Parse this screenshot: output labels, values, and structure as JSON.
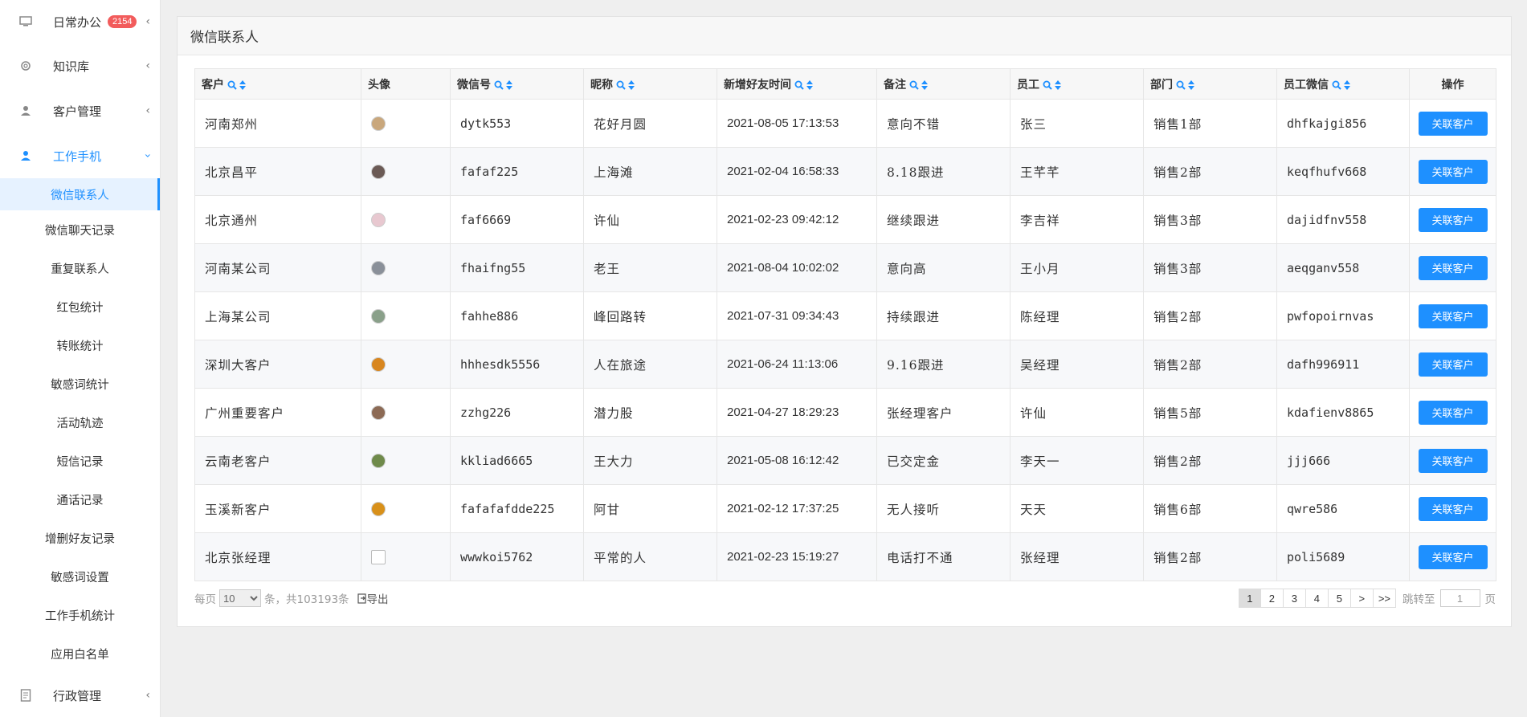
{
  "sidebar": {
    "top_items": [
      {
        "label": "日常办公",
        "icon": "monitor-icon",
        "badge": "2154"
      },
      {
        "label": "知识库",
        "icon": "gear-icon"
      },
      {
        "label": "客户管理",
        "icon": "user-icon"
      },
      {
        "label": "工作手机",
        "icon": "user-icon"
      }
    ],
    "sub_items": [
      "微信联系人",
      "微信聊天记录",
      "重复联系人",
      "红包统计",
      "转账统计",
      "敏感词统计",
      "活动轨迹",
      "短信记录",
      "通话记录",
      "增删好友记录",
      "敏感词设置",
      "工作手机统计",
      "应用白名单"
    ],
    "bottom_item": {
      "label": "行政管理",
      "icon": "document-icon"
    }
  },
  "panel": {
    "title": "微信联系人"
  },
  "table": {
    "headers": [
      "客户",
      "头像",
      "微信号",
      "昵称",
      "新增好友时间",
      "备注",
      "员工",
      "部门",
      "员工微信",
      "操作"
    ],
    "action_label": "关联客户",
    "rows": [
      {
        "customer": "河南郑州",
        "avatar_color": "#c9a77c",
        "wechat": "dytk553",
        "nickname": "花好月圆",
        "time": "2021-08-05 17:13:53",
        "remark": "意向不错",
        "staff": "张三",
        "dept": "销售1部",
        "staff_wechat": "dhfkajgi856"
      },
      {
        "customer": "北京昌平",
        "avatar_color": "#6b5a55",
        "wechat": "fafaf225",
        "nickname": "上海滩",
        "time": "2021-02-04 16:58:33",
        "remark": "8.18跟进",
        "staff": "王芊芊",
        "dept": "销售2部",
        "staff_wechat": "keqfhufv668"
      },
      {
        "customer": "北京通州",
        "avatar_color": "#e8c8d0",
        "wechat": "faf6669",
        "nickname": "许仙",
        "time": "2021-02-23 09:42:12",
        "remark": "继续跟进",
        "staff": "李吉祥",
        "dept": "销售3部",
        "staff_wechat": "dajidfnv558"
      },
      {
        "customer": "河南某公司",
        "avatar_color": "#8a9099",
        "wechat": "fhaifng55",
        "nickname": "老王",
        "time": "2021-08-04 10:02:02",
        "remark": "意向高",
        "staff": "王小月",
        "dept": "销售3部",
        "staff_wechat": "aeqganv558"
      },
      {
        "customer": "上海某公司",
        "avatar_color": "#8aa08a",
        "wechat": "fahhe886",
        "nickname": "峰回路转",
        "time": "2021-07-31 09:34:43",
        "remark": "持续跟进",
        "staff": "陈经理",
        "dept": "销售2部",
        "staff_wechat": "pwfopoirnvas"
      },
      {
        "customer": "深圳大客户",
        "avatar_color": "#d8861f",
        "wechat": "hhhesdk5556",
        "nickname": "人在旅途",
        "time": "2021-06-24 11:13:06",
        "remark": "9.16跟进",
        "staff": "吴经理",
        "dept": "销售2部",
        "staff_wechat": "dafh996911"
      },
      {
        "customer": "广州重要客户",
        "avatar_color": "#8c6a55",
        "wechat": "zzhg226",
        "nickname": "潜力股",
        "time": "2021-04-27 18:29:23",
        "remark": "张经理客户",
        "staff": "许仙",
        "dept": "销售5部",
        "staff_wechat": "kdafienv8865"
      },
      {
        "customer": "云南老客户",
        "avatar_color": "#6f8a4a",
        "wechat": "kkliad6665",
        "nickname": "王大力",
        "time": "2021-05-08 16:12:42",
        "remark": "已交定金",
        "staff": "李天一",
        "dept": "销售2部",
        "staff_wechat": "jjj666"
      },
      {
        "customer": "玉溪新客户",
        "avatar_color": "#d8901a",
        "wechat": "fafafafdde225",
        "nickname": "阿甘",
        "time": "2021-02-12 17:37:25",
        "remark": "无人接听",
        "staff": "天天",
        "dept": "销售6部",
        "staff_wechat": "qwre586"
      },
      {
        "customer": "北京张经理",
        "avatar_color": "",
        "wechat": "wwwkoi5762",
        "nickname": "平常的人",
        "time": "2021-02-23 15:19:27",
        "remark": "电话打不通",
        "staff": "张经理",
        "dept": "销售2部",
        "staff_wechat": "poli5689"
      }
    ]
  },
  "footer": {
    "per_page_prefix": "每页",
    "per_page_value": "10",
    "per_page_suffix": "条，共103193条",
    "export_label": "导出",
    "pages": [
      "1",
      "2",
      "3",
      "4",
      "5",
      ">",
      ">>"
    ],
    "current_page": "1",
    "jump_prefix": "跳转至",
    "jump_value": "1",
    "jump_suffix": "页"
  },
  "colors": {
    "accent": "#1e90ff",
    "badge": "#f25c5c"
  }
}
